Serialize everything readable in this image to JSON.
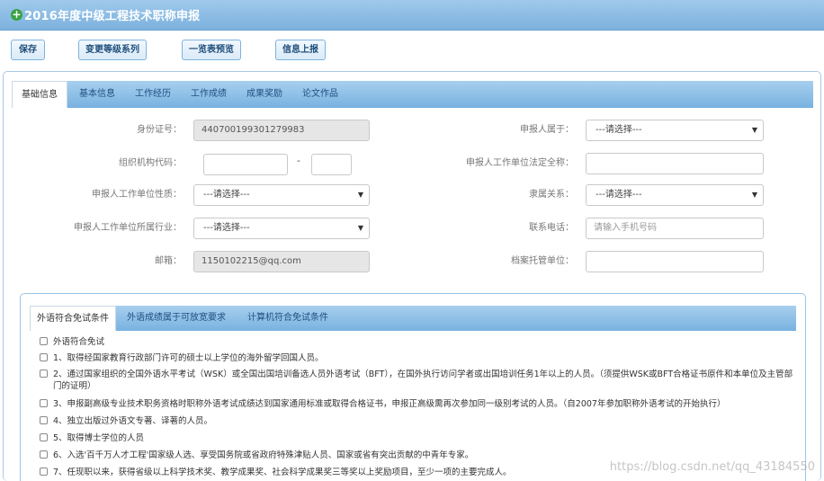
{
  "window": {
    "title": "2016年度中级工程技术职称申报"
  },
  "toolbar": {
    "save_label": "保存",
    "change_level_label": "变更等级系列",
    "preview_label": "一览表预览",
    "submit_label": "信息上报"
  },
  "tabs": [
    "基础信息",
    "基本信息",
    "工作经历",
    "工作成绩",
    "成果奖励",
    "论文作品"
  ],
  "active_tab": "基础信息",
  "form": {
    "id_card": {
      "label": "身份证号：",
      "value": "440700199301279983"
    },
    "org_code": {
      "label": "组织机构代码：",
      "value1": "",
      "value2": "",
      "separator": "-"
    },
    "unit_nature": {
      "label": "申报人工作单位性质：",
      "value": "---请选择---"
    },
    "unit_industry": {
      "label": "申报人工作单位所属行业：",
      "value": "---请选择---"
    },
    "email": {
      "label": "邮箱：",
      "value": "1150102215@qq.com"
    },
    "belongs_to": {
      "label": "申报人属于：",
      "value": "---请选择---"
    },
    "unit_full_name": {
      "label": "申报人工作单位法定全称：",
      "value": ""
    },
    "affiliation": {
      "label": "隶属关系：",
      "value": "---请选择---"
    },
    "phone": {
      "label": "联系电话：",
      "placeholder": "请输入手机号码"
    },
    "archive_unit": {
      "label": "档案托管单位：",
      "value": ""
    }
  },
  "sub_tabs": [
    "外语符合免试条件",
    "外语成绩属于可放宽要求",
    "计算机符合免试条件"
  ],
  "active_sub_tab": "外语符合免试条件",
  "exemptions": [
    "外语符合免试",
    "1、取得经国家教育行政部门许可的硕士以上学位的海外留学回国人员。",
    "2、通过国家组织的全国外语水平考试（WSK）或全国出国培训备选人员外语考试（BFT），在国外执行访问学者或出国培训任务1年以上的人员。（须提供WSK或BFT合格证书原件和本单位及主管部门的证明）",
    "3、申报副高级专业技术职务资格时职称外语考试成绩达到国家通用标准或取得合格证书，申报正高级需再次参加同一级别考试的人员。（自2007年参加职称外语考试的开始执行）",
    "4、独立出版过外语文专著、译著的人员。",
    "5、取得博士学位的人员",
    "6、入选'百千万人才工程'国家级人选、享受国务院或省政府特殊津贴人员、国家或省有突出贡献的中青年专家。",
    "7、任现职以来，获得省级以上科学技术奖、教学成果奖、社会科学成果奖三等奖以上奖励项目，至少一项的主要完成人。"
  ],
  "watermark": "https://blog.csdn.net/qq_43184550",
  "colors": {
    "header": "#7cb1dd",
    "tabbar": "#78b2e0",
    "title_icon": "#3aa345"
  }
}
